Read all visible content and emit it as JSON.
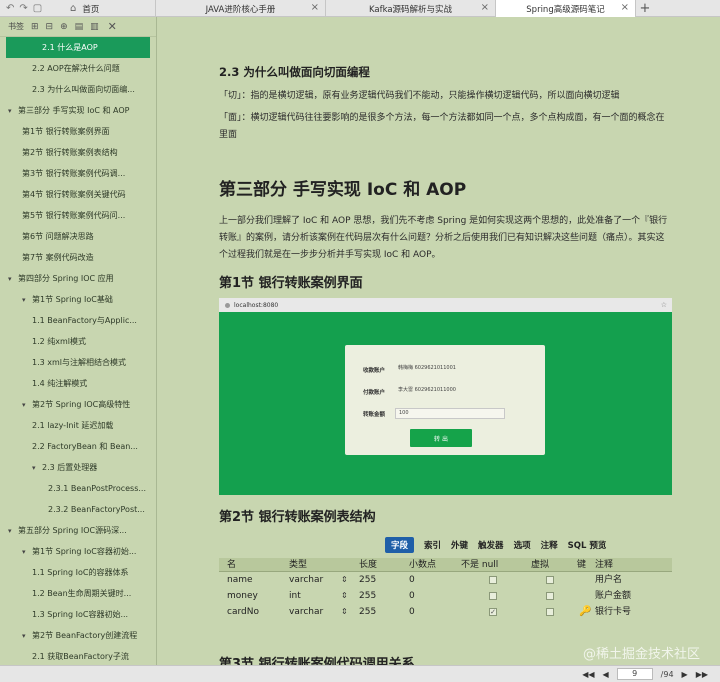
{
  "tabs": {
    "home": "首页",
    "t1": "JAVA进阶核心手册",
    "t2": "Kafka源码解析与实战",
    "t3": "Spring高级源码笔记"
  },
  "sidebar": {
    "title": "书签",
    "items": [
      {
        "label": "2.1 什么是AOP",
        "level": 3,
        "active": true,
        "arrow": ""
      },
      {
        "label": "2.2 AOP在解决什么问题",
        "level": 3,
        "arrow": ""
      },
      {
        "label": "2.3 为什么叫做面向切面编...",
        "level": 3,
        "arrow": ""
      },
      {
        "label": "第三部分 手写实现 IoC 和 AOP",
        "level": 1,
        "arrow": "▾"
      },
      {
        "label": "第1节 银行转账案例界面",
        "level": 2,
        "arrow": ""
      },
      {
        "label": "第2节 银行转账案例表结构",
        "level": 2,
        "arrow": ""
      },
      {
        "label": "第3节 银行转账案例代码调...",
        "level": 2,
        "arrow": ""
      },
      {
        "label": "第4节 银行转账案例关键代码",
        "level": 2,
        "arrow": ""
      },
      {
        "label": "第5节 银行转账案例代码问...",
        "level": 2,
        "arrow": ""
      },
      {
        "label": "第6节 问题解决思路",
        "level": 2,
        "arrow": ""
      },
      {
        "label": "第7节 案例代码改造",
        "level": 2,
        "arrow": ""
      },
      {
        "label": "第四部分 Spring IOC 应用",
        "level": 1,
        "arrow": "▾"
      },
      {
        "label": "第1节 Spring IoC基础",
        "level": 2,
        "arrow": "▾"
      },
      {
        "label": "1.1 BeanFactory与Applic...",
        "level": 3,
        "arrow": ""
      },
      {
        "label": "1.2 纯xml模式",
        "level": 3,
        "arrow": ""
      },
      {
        "label": "1.3 xml与注解相结合模式",
        "level": 3,
        "arrow": ""
      },
      {
        "label": "1.4 纯注解模式",
        "level": 3,
        "arrow": ""
      },
      {
        "label": "第2节 Spring IOC高级特性",
        "level": 2,
        "arrow": "▾"
      },
      {
        "label": "2.1 lazy-Init 延迟加载",
        "level": 3,
        "arrow": ""
      },
      {
        "label": "2.2 FactoryBean 和 Bean...",
        "level": 3,
        "arrow": ""
      },
      {
        "label": "2.3 后置处理器",
        "level": 3,
        "arrow": "▾"
      },
      {
        "label": "2.3.1 BeanPostProcess...",
        "level": 5,
        "arrow": ""
      },
      {
        "label": "2.3.2 BeanFactoryPost...",
        "level": 5,
        "arrow": ""
      },
      {
        "label": "第五部分 Spring IOC源码深...",
        "level": 1,
        "arrow": "▾"
      },
      {
        "label": "第1节 Spring IoC容器初始...",
        "level": 2,
        "arrow": "▾"
      },
      {
        "label": "1.1 Spring IoC的容器体系",
        "level": 3,
        "arrow": ""
      },
      {
        "label": "1.2 Bean生命周期关键时...",
        "level": 3,
        "arrow": ""
      },
      {
        "label": "1.3 Spring IoC容器初始...",
        "level": 3,
        "arrow": ""
      },
      {
        "label": "第2节 BeanFactory创建流程",
        "level": 2,
        "arrow": "▾"
      },
      {
        "label": "2.1 获取BeanFactory子流",
        "level": 3,
        "arrow": ""
      }
    ]
  },
  "main": {
    "h3": "2.3 为什么叫做面向切面编程",
    "p1": "「切」：指的是横切逻辑，原有业务逻辑代码我们不能动，只能操作横切逻辑代码，所以面向横切逻辑",
    "p2": "「面」：横切逻辑代码往往要影响的是很多个方法，每一个方法都如同一个点，多个点构成面，有一个面的概念在里面",
    "h1": "第三部分 手写实现 IoC 和 AOP",
    "p3": "上一部分我们理解了 IoC 和 AOP 思想，我们先不考虑 Spring 是如何实现这两个思想的，此处准备了一个『银行转账』的案例，请分析该案例在代码层次有什么问题？分析之后使用我们已有知识解决这些问题（痛点）。其实这个过程我们就是在一步步分析并手写实现 IoC 和 AOP。",
    "sec1": "第1节 银行转账案例界面",
    "sec2": "第2节 银行转账案例表结构",
    "sec3": "第3节 银行转账案例代码调用关系"
  },
  "shot": {
    "url": "localhost:8080",
    "from_label": "收款账户",
    "from_value": "韩梅梅 6029621011001",
    "to_label": "付款账户",
    "to_value": "李大雷 6029621011000",
    "amount_label": "转账金额",
    "amount_value": "100",
    "button": "转 出"
  },
  "designer": {
    "tabs": [
      "字段",
      "索引",
      "外键",
      "触发器",
      "选项",
      "注释",
      "SQL 预览"
    ],
    "headers": {
      "name": "名",
      "type": "类型",
      "length": "长度",
      "decimal": "小数点",
      "notnull": "不是 null",
      "virtual": "虚拟",
      "key": "键",
      "comment": "注释"
    },
    "rows": [
      {
        "name": "name",
        "type": "varchar",
        "length": "255",
        "decimal": "0",
        "notnull": false,
        "comment": "用户名",
        "key": false
      },
      {
        "name": "money",
        "type": "int",
        "length": "255",
        "decimal": "0",
        "notnull": false,
        "comment": "账户金额",
        "key": false
      },
      {
        "name": "cardNo",
        "type": "varchar",
        "length": "255",
        "decimal": "0",
        "notnull": true,
        "comment": "银行卡号",
        "key": true
      }
    ]
  },
  "status": {
    "page": "9",
    "total": "/94"
  },
  "watermark": "@稀土掘金技术社区"
}
